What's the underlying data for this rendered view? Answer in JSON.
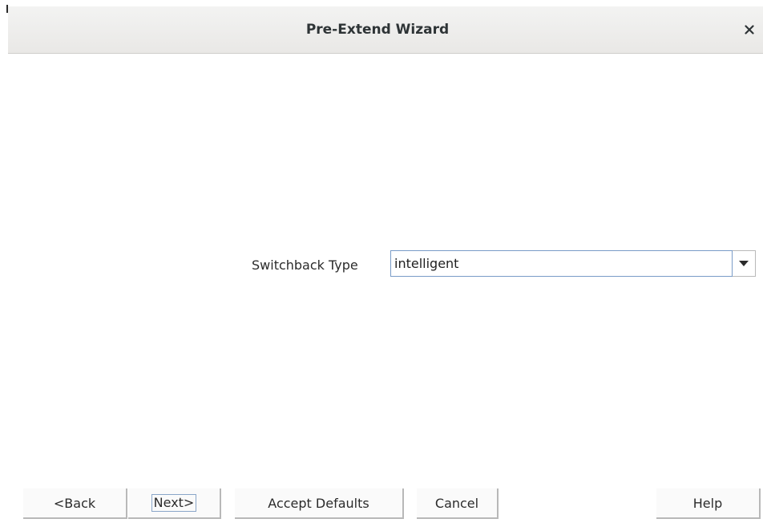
{
  "window": {
    "title": "Pre-Extend Wizard",
    "close_icon": "close-icon"
  },
  "form": {
    "switchback_label": "Switchback Type",
    "switchback_value": "intelligent",
    "dropdown_icon": "chevron-down-icon"
  },
  "buttons": {
    "back": "<Back",
    "next": "Next>",
    "accept_defaults": "Accept Defaults",
    "cancel": "Cancel",
    "help": "Help"
  },
  "colors": {
    "focus_border": "#7a9cc7",
    "titlebar_bg": "#eeedeb"
  }
}
